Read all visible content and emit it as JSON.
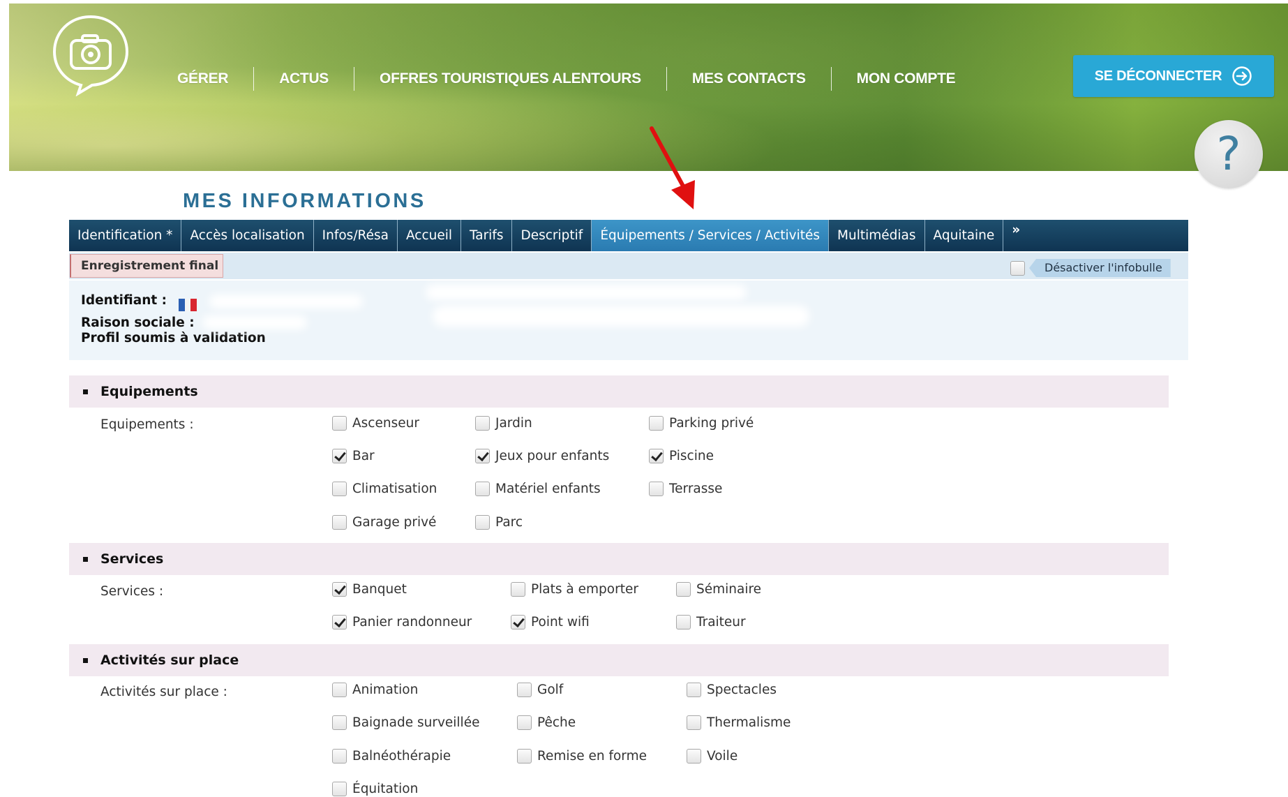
{
  "header": {
    "nav": [
      "GÉRER",
      "ACTUS",
      "OFFRES TOURISTIQUES ALENTOURS",
      "MES CONTACTS",
      "MON COMPTE"
    ],
    "logout_label": "SE DÉCONNECTER",
    "help_label": "?"
  },
  "page": {
    "title": "MES INFORMATIONS"
  },
  "tabs": {
    "items": [
      "Identification *",
      "Accès localisation",
      "Infos/Résa",
      "Accueil",
      "Tarifs",
      "Descriptif",
      "Équipements / Services / Activités",
      "Multimédias",
      "Aquitaine",
      "»"
    ],
    "active": "Équipements / Services / Activités"
  },
  "subbar": {
    "final_label": "Enregistrement final",
    "tooltip_label": "Désactiver l'infobulle"
  },
  "ident": {
    "identifiant_label": "Identifiant :",
    "raison_label": "Raison sociale :",
    "profil_label": "Profil soumis à validation"
  },
  "sections": {
    "equipements": {
      "title": "Equipements",
      "field_label": "Equipements :",
      "options": [
        {
          "label": "Ascenseur",
          "checked": false
        },
        {
          "label": "Jardin",
          "checked": false
        },
        {
          "label": "Parking privé",
          "checked": false
        },
        {
          "label": "Bar",
          "checked": true
        },
        {
          "label": "Jeux pour enfants",
          "checked": true
        },
        {
          "label": "Piscine",
          "checked": true
        },
        {
          "label": "Climatisation",
          "checked": false
        },
        {
          "label": "Matériel enfants",
          "checked": false
        },
        {
          "label": "Terrasse",
          "checked": false
        },
        {
          "label": "Garage privé",
          "checked": false
        },
        {
          "label": "Parc",
          "checked": false
        }
      ]
    },
    "services": {
      "title": "Services",
      "field_label": "Services :",
      "options": [
        {
          "label": "Banquet",
          "checked": true
        },
        {
          "label": "Plats à emporter",
          "checked": false
        },
        {
          "label": "Séminaire",
          "checked": false
        },
        {
          "label": "Panier randonneur",
          "checked": true
        },
        {
          "label": "Point wifi",
          "checked": true
        },
        {
          "label": "Traiteur",
          "checked": false
        }
      ]
    },
    "activites": {
      "title": "Activités sur place",
      "field_label": "Activités sur place :",
      "options": [
        {
          "label": "Animation",
          "checked": false
        },
        {
          "label": "Golf",
          "checked": false
        },
        {
          "label": "Spectacles",
          "checked": false
        },
        {
          "label": "Baignade surveillée",
          "checked": false
        },
        {
          "label": "Pêche",
          "checked": false
        },
        {
          "label": "Thermalisme",
          "checked": false
        },
        {
          "label": "Balnéothérapie",
          "checked": false
        },
        {
          "label": "Remise en forme",
          "checked": false
        },
        {
          "label": "Voile",
          "checked": false
        },
        {
          "label": "Équitation",
          "checked": false
        }
      ]
    }
  },
  "colors": {
    "accent": "#29a8d6",
    "title": "#2b6f95",
    "tabbar": "#0f3452",
    "tab_active": "#2a7bb1",
    "arrow": "#e01010"
  }
}
